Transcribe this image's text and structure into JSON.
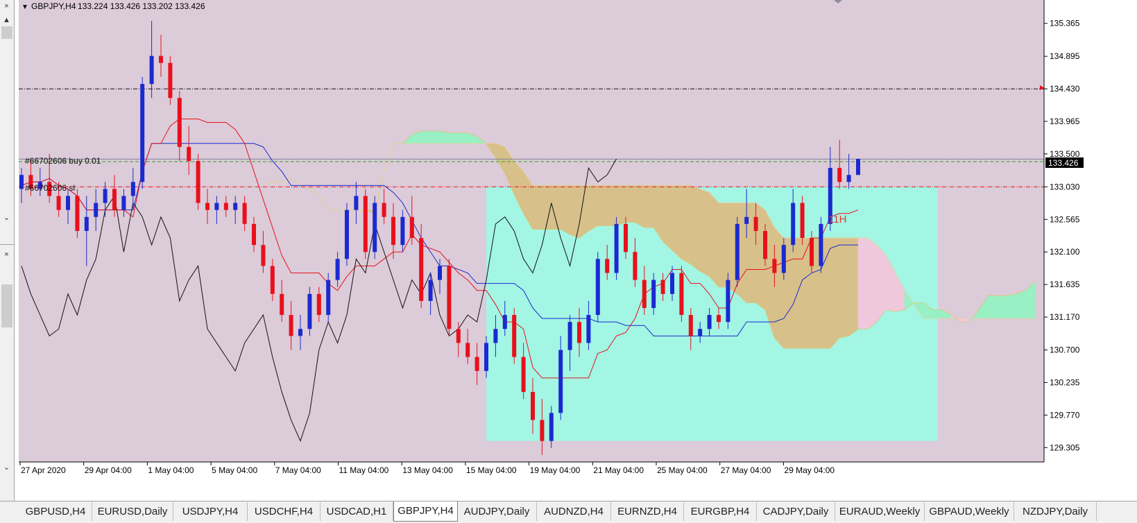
{
  "chart_header": {
    "symbol_timeframe": "GBPJPY,H4",
    "ohlc": "133.224 133.426 133.202 133.426"
  },
  "icons": {
    "menu_arrow": "triangle-down-icon",
    "close": "close-icon",
    "scroll_up": "chevron-up-icon",
    "scroll_down": "chevron-down-icon",
    "top_marker": "diamond-icon",
    "level_arrow": "arrow-right-icon"
  },
  "left_panel": {
    "close_top": "×",
    "close_bottom": "×"
  },
  "order_labels": {
    "buy": "#66702606 buy 0.01",
    "sl": "#66702606 sl"
  },
  "annotation": {
    "text": "11H",
    "color": "#e53935"
  },
  "price_axis": {
    "ticks": [
      "135.365",
      "134.895",
      "134.430",
      "133.965",
      "133.500",
      "133.030",
      "132.565",
      "132.100",
      "131.635",
      "131.170",
      "130.700",
      "130.235",
      "129.770",
      "129.305"
    ],
    "current_price": "133.426"
  },
  "time_axis": {
    "labels": [
      "27 Apr 2020",
      "29 Apr 04:00",
      "1 May 04:00",
      "5 May 04:00",
      "7 May 04:00",
      "11 May 04:00",
      "13 May 04:00",
      "15 May 04:00",
      "19 May 04:00",
      "21 May 04:00",
      "25 May 04:00",
      "27 May 04:00",
      "29 May 04:00"
    ]
  },
  "tabs": [
    {
      "label": "GBPUSD,H4",
      "active": false
    },
    {
      "label": "EURUSD,Daily",
      "active": false
    },
    {
      "label": "USDJPY,H4",
      "active": false
    },
    {
      "label": "USDCHF,H4",
      "active": false
    },
    {
      "label": "USDCAD,H1",
      "active": false
    },
    {
      "label": "GBPJPY,H4",
      "active": true
    },
    {
      "label": "AUDJPY,Daily",
      "active": false
    },
    {
      "label": "AUDNZD,H4",
      "active": false
    },
    {
      "label": "EURNZD,H4",
      "active": false
    },
    {
      "label": "EURGBP,H4",
      "active": false
    },
    {
      "label": "CADJPY,Daily",
      "active": false
    },
    {
      "label": "EURAUD,Weekly",
      "active": false
    },
    {
      "label": "GBPAUD,Weekly",
      "active": false
    },
    {
      "label": "NZDJPY,Daily",
      "active": false
    }
  ],
  "colors": {
    "background": "#dccbd8",
    "bull_candle": "#1a2ad0",
    "bear_candle": "#e8101c",
    "tenkan": "#e8101c",
    "kijun": "#1a2ad0",
    "chikou": "#111111",
    "kumo_bear": "#d7c08a",
    "kumo_bull": "#98f0c4",
    "kumo_bear_future": "#f0c8dc",
    "zone_box": "#a3f5e4",
    "highlight_zone": "#a8ec8a",
    "bid_line": "#7f7f9c",
    "order_line": "#2e9f2e",
    "sl_line": "#e8101c",
    "resistance_line": "#111111"
  },
  "chart_data": {
    "type": "candlestick",
    "symbol": "GBPJPY",
    "timeframe": "H4",
    "ylim": [
      129.1,
      135.6
    ],
    "levels": {
      "bid": 133.426,
      "order_buy": 133.39,
      "stop_loss": 133.03,
      "resistance": 134.43
    },
    "candles": [
      {
        "o": 133.0,
        "h": 133.3,
        "l": 132.8,
        "c": 133.2
      },
      {
        "o": 133.2,
        "h": 133.4,
        "l": 132.9,
        "c": 133.0
      },
      {
        "o": 133.0,
        "h": 133.3,
        "l": 132.9,
        "c": 133.1
      },
      {
        "o": 133.1,
        "h": 133.5,
        "l": 132.8,
        "c": 132.9
      },
      {
        "o": 132.9,
        "h": 133.1,
        "l": 132.6,
        "c": 132.7
      },
      {
        "o": 132.7,
        "h": 133.0,
        "l": 132.5,
        "c": 132.9
      },
      {
        "o": 132.9,
        "h": 133.0,
        "l": 132.3,
        "c": 132.4
      },
      {
        "o": 132.4,
        "h": 132.9,
        "l": 131.9,
        "c": 132.6
      },
      {
        "o": 132.6,
        "h": 133.0,
        "l": 132.4,
        "c": 132.8
      },
      {
        "o": 132.8,
        "h": 133.1,
        "l": 132.6,
        "c": 133.0
      },
      {
        "o": 133.0,
        "h": 133.2,
        "l": 132.6,
        "c": 132.7
      },
      {
        "o": 132.7,
        "h": 133.0,
        "l": 132.6,
        "c": 132.9
      },
      {
        "o": 132.9,
        "h": 133.3,
        "l": 132.7,
        "c": 133.1
      },
      {
        "o": 133.1,
        "h": 134.6,
        "l": 133.0,
        "c": 134.5
      },
      {
        "o": 134.5,
        "h": 135.4,
        "l": 134.3,
        "c": 134.9
      },
      {
        "o": 134.9,
        "h": 135.2,
        "l": 134.6,
        "c": 134.8
      },
      {
        "o": 134.8,
        "h": 134.9,
        "l": 134.2,
        "c": 134.3
      },
      {
        "o": 134.3,
        "h": 134.4,
        "l": 133.4,
        "c": 133.6
      },
      {
        "o": 133.6,
        "h": 133.9,
        "l": 133.2,
        "c": 133.4
      },
      {
        "o": 133.4,
        "h": 133.5,
        "l": 132.7,
        "c": 132.8
      },
      {
        "o": 132.8,
        "h": 133.0,
        "l": 132.5,
        "c": 132.7
      },
      {
        "o": 132.7,
        "h": 132.9,
        "l": 132.5,
        "c": 132.8
      },
      {
        "o": 132.8,
        "h": 132.9,
        "l": 132.6,
        "c": 132.7
      },
      {
        "o": 132.7,
        "h": 132.9,
        "l": 132.5,
        "c": 132.8
      },
      {
        "o": 132.8,
        "h": 132.9,
        "l": 132.4,
        "c": 132.5
      },
      {
        "o": 132.5,
        "h": 132.6,
        "l": 132.1,
        "c": 132.2
      },
      {
        "o": 132.2,
        "h": 132.4,
        "l": 131.8,
        "c": 131.9
      },
      {
        "o": 131.9,
        "h": 132.0,
        "l": 131.4,
        "c": 131.5
      },
      {
        "o": 131.5,
        "h": 131.7,
        "l": 131.1,
        "c": 131.2
      },
      {
        "o": 131.2,
        "h": 131.4,
        "l": 130.7,
        "c": 130.9
      },
      {
        "o": 130.9,
        "h": 131.2,
        "l": 130.7,
        "c": 131.0
      },
      {
        "o": 131.0,
        "h": 131.6,
        "l": 130.9,
        "c": 131.5
      },
      {
        "o": 131.5,
        "h": 131.6,
        "l": 131.1,
        "c": 131.2
      },
      {
        "o": 131.2,
        "h": 131.8,
        "l": 131.1,
        "c": 131.7
      },
      {
        "o": 131.7,
        "h": 132.1,
        "l": 131.6,
        "c": 132.0
      },
      {
        "o": 132.0,
        "h": 132.8,
        "l": 131.9,
        "c": 132.7
      },
      {
        "o": 132.7,
        "h": 133.1,
        "l": 132.5,
        "c": 132.9
      },
      {
        "o": 132.9,
        "h": 133.0,
        "l": 132.0,
        "c": 132.1
      },
      {
        "o": 132.1,
        "h": 132.9,
        "l": 132.0,
        "c": 132.8
      },
      {
        "o": 132.8,
        "h": 133.0,
        "l": 132.5,
        "c": 132.6
      },
      {
        "o": 132.6,
        "h": 132.8,
        "l": 132.0,
        "c": 132.2
      },
      {
        "o": 132.2,
        "h": 132.7,
        "l": 132.1,
        "c": 132.6
      },
      {
        "o": 132.6,
        "h": 132.9,
        "l": 132.2,
        "c": 132.3
      },
      {
        "o": 132.3,
        "h": 132.5,
        "l": 131.3,
        "c": 131.4
      },
      {
        "o": 131.4,
        "h": 131.8,
        "l": 131.2,
        "c": 131.7
      },
      {
        "o": 131.7,
        "h": 132.0,
        "l": 131.5,
        "c": 131.9
      },
      {
        "o": 131.9,
        "h": 132.0,
        "l": 130.9,
        "c": 131.0
      },
      {
        "o": 131.0,
        "h": 131.1,
        "l": 130.6,
        "c": 130.8
      },
      {
        "o": 130.8,
        "h": 131.0,
        "l": 130.5,
        "c": 130.6
      },
      {
        "o": 130.6,
        "h": 130.8,
        "l": 130.2,
        "c": 130.4
      },
      {
        "o": 130.4,
        "h": 130.9,
        "l": 130.3,
        "c": 130.8
      },
      {
        "o": 130.8,
        "h": 131.2,
        "l": 130.6,
        "c": 131.0
      },
      {
        "o": 131.0,
        "h": 131.4,
        "l": 130.9,
        "c": 131.2
      },
      {
        "o": 131.2,
        "h": 131.3,
        "l": 130.5,
        "c": 130.6
      },
      {
        "o": 130.6,
        "h": 130.8,
        "l": 130.0,
        "c": 130.1
      },
      {
        "o": 130.1,
        "h": 130.3,
        "l": 129.5,
        "c": 129.7
      },
      {
        "o": 129.7,
        "h": 130.0,
        "l": 129.2,
        "c": 129.4
      },
      {
        "o": 129.4,
        "h": 129.9,
        "l": 129.3,
        "c": 129.8
      },
      {
        "o": 129.8,
        "h": 130.9,
        "l": 129.7,
        "c": 130.7
      },
      {
        "o": 130.7,
        "h": 131.2,
        "l": 130.4,
        "c": 131.1
      },
      {
        "o": 131.1,
        "h": 131.3,
        "l": 130.6,
        "c": 130.8
      },
      {
        "o": 130.8,
        "h": 131.4,
        "l": 130.7,
        "c": 131.2
      },
      {
        "o": 131.2,
        "h": 132.1,
        "l": 131.1,
        "c": 132.0
      },
      {
        "o": 132.0,
        "h": 132.2,
        "l": 131.7,
        "c": 131.8
      },
      {
        "o": 131.8,
        "h": 132.6,
        "l": 131.7,
        "c": 132.5
      },
      {
        "o": 132.5,
        "h": 132.6,
        "l": 132.0,
        "c": 132.1
      },
      {
        "o": 132.1,
        "h": 132.3,
        "l": 131.6,
        "c": 131.7
      },
      {
        "o": 131.7,
        "h": 131.9,
        "l": 131.2,
        "c": 131.3
      },
      {
        "o": 131.3,
        "h": 131.8,
        "l": 131.2,
        "c": 131.7
      },
      {
        "o": 131.7,
        "h": 131.8,
        "l": 131.4,
        "c": 131.5
      },
      {
        "o": 131.5,
        "h": 131.9,
        "l": 131.4,
        "c": 131.8
      },
      {
        "o": 131.8,
        "h": 131.9,
        "l": 131.1,
        "c": 131.2
      },
      {
        "o": 131.2,
        "h": 131.3,
        "l": 130.7,
        "c": 130.9
      },
      {
        "o": 130.9,
        "h": 131.1,
        "l": 130.8,
        "c": 131.0
      },
      {
        "o": 131.0,
        "h": 131.3,
        "l": 130.9,
        "c": 131.2
      },
      {
        "o": 131.2,
        "h": 131.3,
        "l": 131.0,
        "c": 131.1
      },
      {
        "o": 131.1,
        "h": 131.8,
        "l": 131.0,
        "c": 131.7
      },
      {
        "o": 131.7,
        "h": 132.6,
        "l": 131.6,
        "c": 132.5
      },
      {
        "o": 132.5,
        "h": 133.0,
        "l": 132.3,
        "c": 132.6
      },
      {
        "o": 132.6,
        "h": 132.8,
        "l": 132.2,
        "c": 132.4
      },
      {
        "o": 132.4,
        "h": 132.5,
        "l": 131.9,
        "c": 132.0
      },
      {
        "o": 132.0,
        "h": 132.2,
        "l": 131.6,
        "c": 131.8
      },
      {
        "o": 131.8,
        "h": 132.3,
        "l": 131.7,
        "c": 132.2
      },
      {
        "o": 132.2,
        "h": 133.0,
        "l": 132.1,
        "c": 132.8
      },
      {
        "o": 132.8,
        "h": 132.9,
        "l": 132.2,
        "c": 132.3
      },
      {
        "o": 132.3,
        "h": 132.4,
        "l": 131.8,
        "c": 131.9
      },
      {
        "o": 131.9,
        "h": 132.6,
        "l": 131.8,
        "c": 132.5
      },
      {
        "o": 132.5,
        "h": 133.6,
        "l": 132.4,
        "c": 133.3
      },
      {
        "o": 133.3,
        "h": 133.7,
        "l": 133.0,
        "c": 133.1
      },
      {
        "o": 133.1,
        "h": 133.5,
        "l": 133.0,
        "c": 133.2
      },
      {
        "o": 133.2,
        "h": 133.4,
        "l": 133.2,
        "c": 133.43
      }
    ]
  }
}
